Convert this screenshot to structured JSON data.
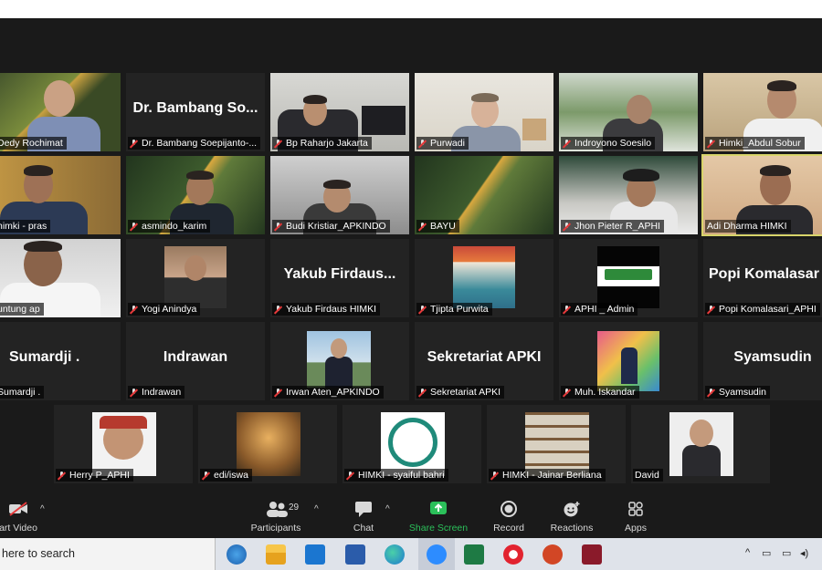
{
  "participants": [
    {
      "name": "Dedy Rochimat"
    },
    {
      "name": "Dr. Bambang Soepijanto-...",
      "big": "Dr. Bambang So..."
    },
    {
      "name": "Bp Raharjo Jakarta"
    },
    {
      "name": "Purwadi"
    },
    {
      "name": "Indroyono Soesilo"
    },
    {
      "name": "Himki_Abdul Sobur"
    },
    {
      "name": "himki - pras"
    },
    {
      "name": "asmindo_karim"
    },
    {
      "name": "Budi Kristiar_APKINDO"
    },
    {
      "name": "BAYU"
    },
    {
      "name": "Jhon Pieter R_APHI"
    },
    {
      "name": "Adi Dharma HIMKI"
    },
    {
      "name": "untung ap"
    },
    {
      "name": "Yogi Anindya"
    },
    {
      "name": "Yakub Firdaus HIMKI",
      "big": "Yakub  Firdaus..."
    },
    {
      "name": "Tjipta Purwita"
    },
    {
      "name": "APHI _ Admin"
    },
    {
      "name": "Popi Komalasari_APHI",
      "big": "Popi  Komalasar"
    },
    {
      "name": "Sumardji .",
      "big": "Sumardji ."
    },
    {
      "name": "Indrawan",
      "big": "Indrawan"
    },
    {
      "name": "Irwan Aten_APKINDO"
    },
    {
      "name": "Sekretariat APKI",
      "big": "Sekretariat APKI"
    },
    {
      "name": "Muh. Iskandar"
    },
    {
      "name": "Syamsudin",
      "big": "Syamsudin"
    },
    {
      "name": "Herry P_APHI"
    },
    {
      "name": "edi/iswa"
    },
    {
      "name": "HIMKI - syaiful bahri"
    },
    {
      "name": "HIMKI - Jainar Berliana"
    },
    {
      "name": "David"
    }
  ],
  "toolbar": {
    "start_video": "art Video",
    "participants_label": "Participants",
    "participants_count": "29",
    "chat": "Chat",
    "share_screen": "Share Screen",
    "record": "Record",
    "reactions": "Reactions",
    "apps": "Apps",
    "share_color": "#2bc05a"
  },
  "taskbar": {
    "search_text": "here to search"
  }
}
